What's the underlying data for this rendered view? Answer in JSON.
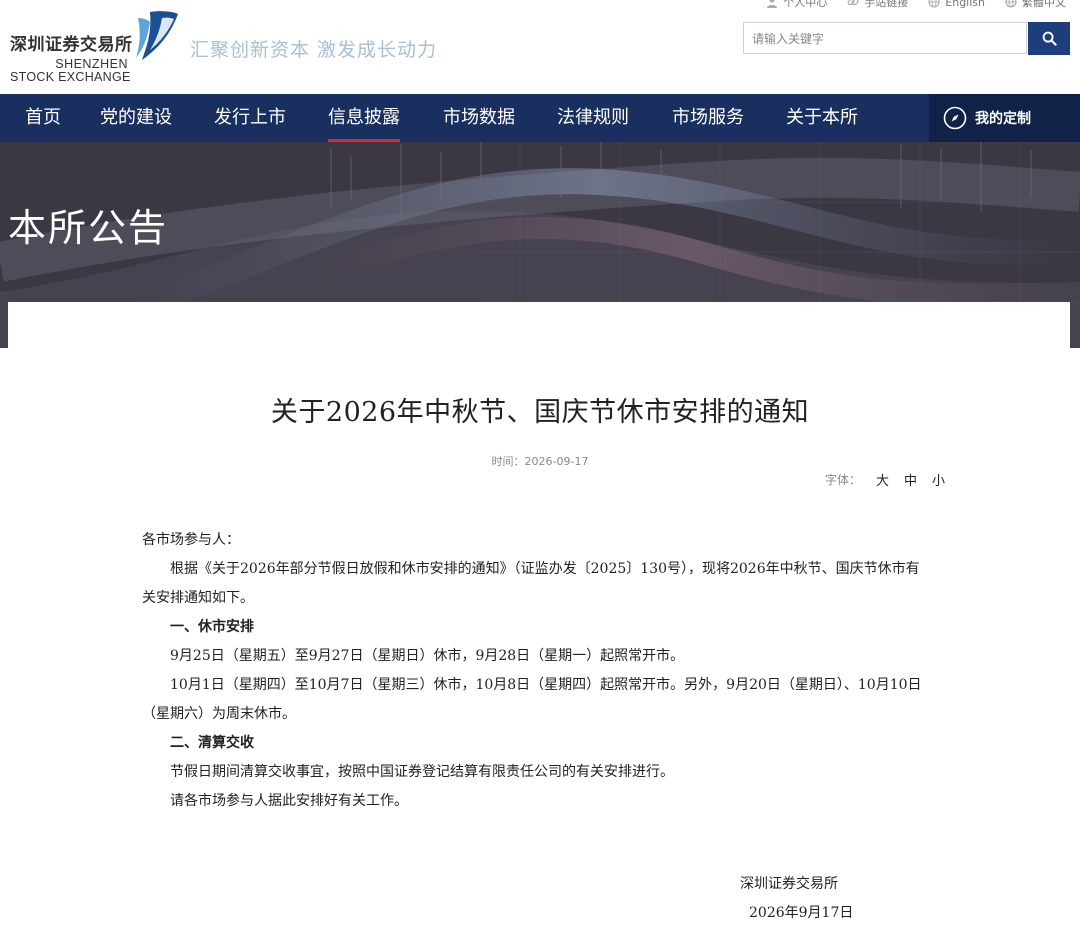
{
  "header": {
    "logo": {
      "cn": "深圳证券交易所",
      "en_line1": "SHENZHEN",
      "en_line2": "STOCK EXCHANGE"
    },
    "slogan": "汇聚创新资本 激发成长动力",
    "top_links": [
      {
        "label": "个人中心",
        "icon": "user-icon"
      },
      {
        "label": "手站链接",
        "icon": "link-icon"
      },
      {
        "label": "English",
        "icon": "globe-icon"
      },
      {
        "label": "繁體中文",
        "icon": "globe-icon"
      }
    ],
    "search": {
      "placeholder": "请输入关键字",
      "value": ""
    }
  },
  "nav": {
    "items": [
      {
        "label": "首页",
        "active": false
      },
      {
        "label": "党的建设",
        "active": false
      },
      {
        "label": "发行上市",
        "active": false
      },
      {
        "label": "信息披露",
        "active": true
      },
      {
        "label": "市场数据",
        "active": false
      },
      {
        "label": "法律规则",
        "active": false
      },
      {
        "label": "市场服务",
        "active": false
      },
      {
        "label": "关于本所",
        "active": false
      }
    ],
    "custom_label": "我的定制",
    "active_color": "#d9262d",
    "bar_color": "#182f60"
  },
  "banner": {
    "title": "本所公告"
  },
  "article": {
    "title": "关于2026年中秋节、国庆节休市安排的通知",
    "time_label": "时间：",
    "time": "2026-09-17",
    "font_size_label": "字体：",
    "font_sizes": [
      "大",
      "中",
      "小"
    ],
    "salutation": "各市场参与人：",
    "paragraphs": [
      "根据《关于2026年部分节假日放假和休市安排的通知》（证监办发〔2025〕130号），现将2026年中秋节、国庆节休市有关安排通知如下。",
      "一、休市安排",
      "9月25日（星期五）至9月27日（星期日）休市，9月28日（星期一）起照常开市。",
      "10月1日（星期四）至10月7日（星期三）休市，10月8日（星期四）起照常开市。另外，9月20日（星期日）、10月10日（星期六）为周末休市。",
      "二、清算交收",
      "节假日期间清算交收事宜，按照中国证券登记结算有限责任公司的有关安排进行。",
      "请各市场参与人据此安排好有关工作。"
    ],
    "signature_org": "深圳证券交易所",
    "signature_date": "2026年9月17日"
  }
}
